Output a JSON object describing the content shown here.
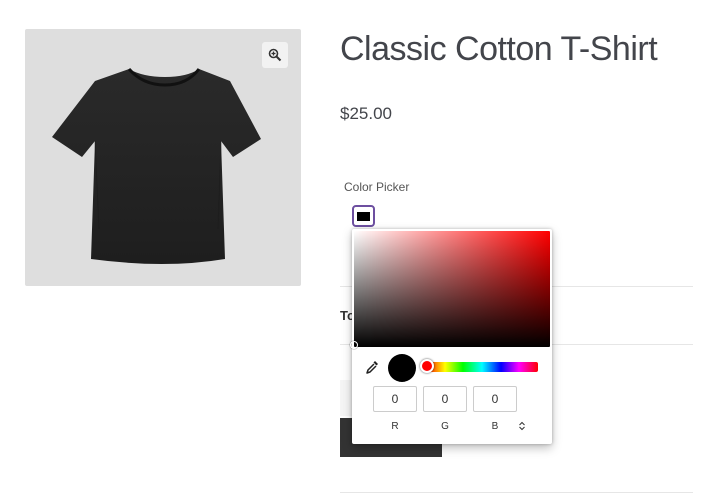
{
  "product": {
    "title": "Classic Cotton T-Shirt",
    "price": "$25.00",
    "image_icon": "tshirt-image",
    "zoom_icon": "zoom-in-icon"
  },
  "color_picker": {
    "label": "Color Picker",
    "selected_color": "#000000",
    "hue_color": "#ff0000",
    "r": "0",
    "g": "0",
    "b": "0",
    "r_label": "R",
    "g_label": "G",
    "b_label": "B",
    "eyedropper_icon": "eyedropper-icon",
    "mode_toggle_icon": "up-down-arrows-icon"
  },
  "background": {
    "total_label": "To"
  },
  "colors": {
    "swatch_border": "#6d4fa0",
    "button_dark": "#333333"
  }
}
